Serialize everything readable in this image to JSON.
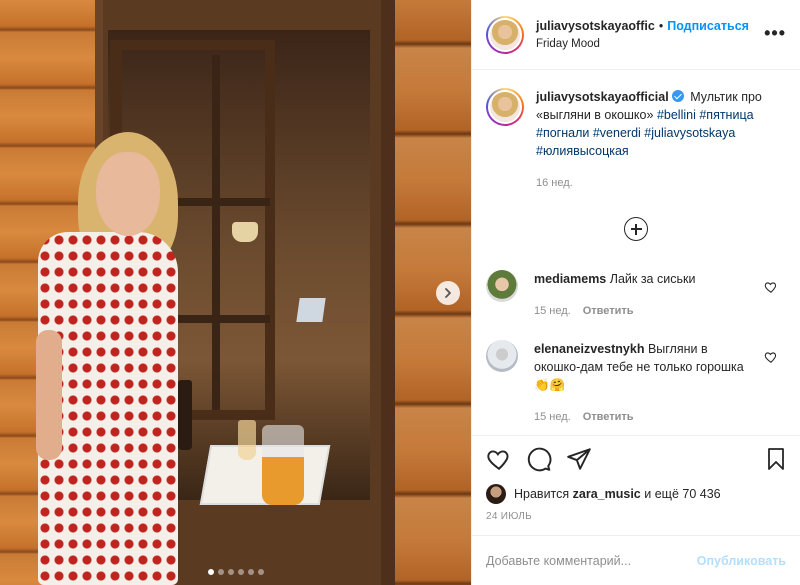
{
  "post": {
    "slides_total": 6,
    "slide_active": 1
  },
  "header": {
    "username": "juliavysotskayaofficial",
    "username_display": "juliavysotskayaoffic",
    "separator": "•",
    "follow_label": "Подписаться",
    "location": "Friday Mood",
    "more_label": "•••"
  },
  "caption": {
    "username": "juliavysotskayaofficial",
    "text_lead": "Мультик про «выгляни в окошко»",
    "hashtags": [
      "#bellini",
      "#пятница",
      "#погнали",
      "#venerdi",
      "#juliavysotskaya",
      "#юлиявысоцкая"
    ],
    "time": "16 нед."
  },
  "comments": [
    {
      "username": "mediamems",
      "text": "Лайк за сиськи",
      "time": "15 нед.",
      "reply_label": "Ответить"
    },
    {
      "username": "elenaneizvestnykh",
      "text": "Выгляни в окошко-дам тебе не только горошка👏🤗",
      "time": "15 нед.",
      "reply_label": "Ответить"
    }
  ],
  "likes": {
    "prefix": "Нравится",
    "user": "zara_music",
    "suffix": "и ещё 70 436"
  },
  "date": "24 ИЮЛЬ",
  "add_comment": {
    "placeholder": "Добавьте комментарий...",
    "publish_label": "Опубликовать"
  },
  "icons": {
    "like": "heart-icon",
    "comment": "comment-icon",
    "share": "share-icon",
    "save": "bookmark-icon",
    "next": "chevron-right-icon",
    "expand": "plus-circle-icon"
  },
  "colors": {
    "link": "#0095f6",
    "hashtag": "#00376b",
    "muted": "#8e8e8e",
    "publish_disabled": "#b2dffc"
  }
}
